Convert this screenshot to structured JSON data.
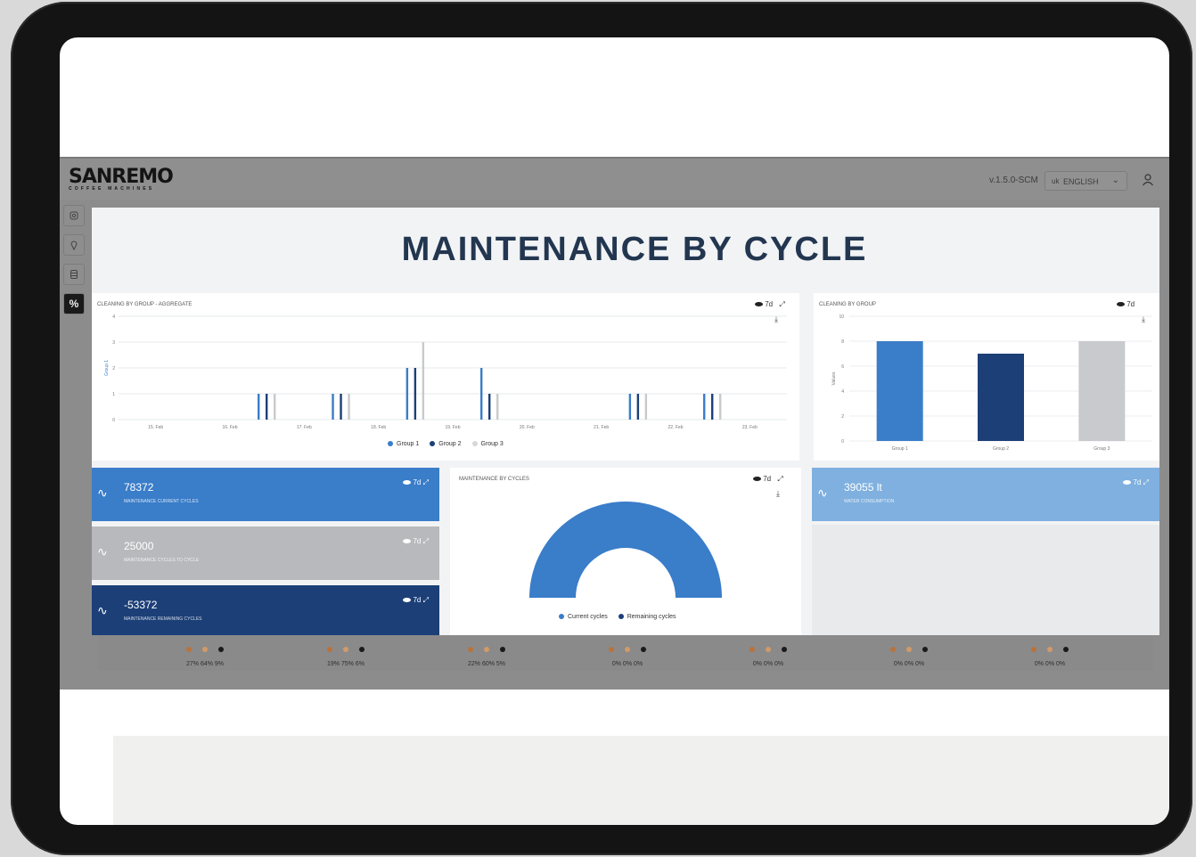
{
  "brand": {
    "name": "SANREMO",
    "tagline": "COFFEE MACHINES"
  },
  "header": {
    "version": "v.1.5.0-SCM",
    "language": "ENGLISH",
    "language_flag": "uk"
  },
  "sidebar": {
    "items": [
      {
        "icon": "coffee-machine-icon"
      },
      {
        "icon": "location-pin-icon"
      },
      {
        "icon": "database-icon"
      },
      {
        "icon": "percent-icon",
        "active": true
      }
    ]
  },
  "page": {
    "title": "MAINTENANCE BY CYCLE"
  },
  "cards": {
    "aggregate": {
      "title": "CLEANING BY GROUP - AGGREGATE",
      "tools": "7d"
    },
    "by_group": {
      "title": "CLEANING BY GROUP",
      "tools": "7d"
    },
    "cycles": {
      "title": "MAINTENANCE BY CYCLES",
      "tools": "7d"
    }
  },
  "kpis": [
    {
      "value": "78372",
      "label": "MAINTENANCE CURRENT CYCLES",
      "tools": "7d",
      "color": "#3a7dc9"
    },
    {
      "value": "25000",
      "label": "MAINTENANCE CYCLES TO CYCLE",
      "tools": "7d",
      "color": "#b7b9bc"
    },
    {
      "value": "-53372",
      "label": "MAINTENANCE REMAINING CYCLES",
      "tools": "7d",
      "color": "#1c3f78"
    },
    {
      "value": "39055 lt",
      "label": "WATER CONSUMPTION",
      "tools": "7d",
      "color": "#7fb0df"
    }
  ],
  "chart_data": [
    {
      "type": "bar",
      "title": "CLEANING BY GROUP - AGGREGATE",
      "categories": [
        "15. Feb",
        "16. Feb",
        "17. Feb",
        "18. Feb",
        "19. Feb",
        "20. Feb",
        "21. Feb",
        "22. Feb",
        "23. Feb"
      ],
      "ylim": [
        0,
        4
      ],
      "ylabel": "Group 1",
      "series": [
        {
          "name": "Group 1",
          "values": [
            0,
            1,
            1,
            2,
            2,
            0,
            1,
            1,
            0
          ],
          "color": "#3a7dc9"
        },
        {
          "name": "Group 2",
          "values": [
            0,
            1,
            1,
            2,
            1,
            0,
            1,
            1,
            0
          ],
          "color": "#1c3f78"
        },
        {
          "name": "Group 3",
          "values": [
            0,
            1,
            1,
            3,
            1,
            0,
            1,
            1,
            0
          ],
          "color": "#c8cacd"
        }
      ],
      "legend": "bottom"
    },
    {
      "type": "bar",
      "title": "CLEANING BY GROUP",
      "categories": [
        "Group 1",
        "Group 2",
        "Group 3"
      ],
      "values": [
        8,
        7,
        8
      ],
      "colors": [
        "#3a7dc9",
        "#1c3f78",
        "#c8cacd"
      ],
      "ylim": [
        0,
        10
      ],
      "ylabel": "Values"
    },
    {
      "type": "pie",
      "title": "MAINTENANCE BY CYCLES",
      "labels": [
        "Current cycles",
        "Remaining cycles"
      ],
      "values": [
        78372,
        0
      ],
      "colors": [
        "#3a7dc9",
        "#1c3f78"
      ],
      "legend": "bottom"
    }
  ],
  "status_groups": [
    {
      "text": "27% 64% 9%"
    },
    {
      "text": "19% 75% 6%"
    },
    {
      "text": "22% 60% 5%"
    },
    {
      "text": "0% 0% 0%"
    },
    {
      "text": "0% 0% 0%"
    },
    {
      "text": "0% 0% 0%"
    },
    {
      "text": "0% 0% 0%"
    }
  ],
  "status_colors": [
    "#b8733c",
    "#d19a6a",
    "#1a1a1a"
  ]
}
